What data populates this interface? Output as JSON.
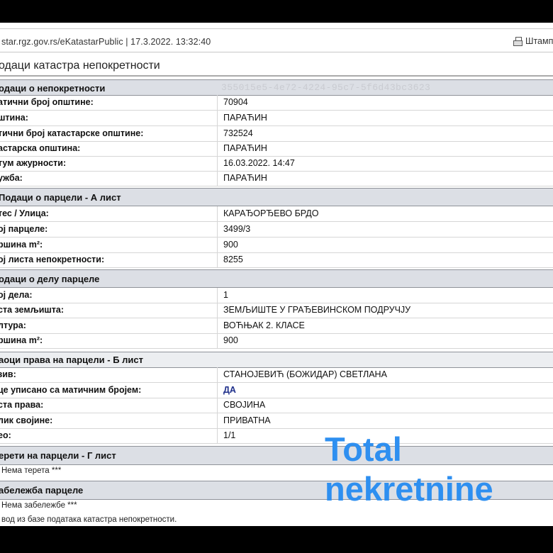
{
  "url_line": "star.rgz.gov.rs/eKatastarPublic | 17.3.2022. 13:32:40",
  "print_label": "Штамп",
  "page_title": "одаци катастра непокретности",
  "sections": {
    "property": {
      "title": "одаци о непокретности",
      "uuid": "355015e5-4e72-4224-95c7-5f6d43bc3623"
    },
    "parcel": {
      "title": "Подаци о парцели - А лист"
    },
    "part": {
      "title": "одаци о делу парцеле"
    },
    "rights": {
      "title": "аоци права на парцели - Б лист"
    },
    "burdens": {
      "title": "ерети на парцели - Г лист"
    },
    "notes": {
      "title": "абележба парцеле"
    }
  },
  "property_rows": [
    {
      "label": "атични број општине:",
      "value": "70904"
    },
    {
      "label": "штина:",
      "value": "ПАРАЋИН"
    },
    {
      "label": "тични број катастарске општине:",
      "value": "732524"
    },
    {
      "label": "астарска општина:",
      "value": "ПАРАЋИН"
    },
    {
      "label": "тум ажурности:",
      "value": "16.03.2022. 14:47"
    },
    {
      "label": "ужба:",
      "value": "ПАРАЋИН"
    }
  ],
  "parcel_rows": [
    {
      "label": "тес / Улица:",
      "value": "КАРАЂОРЂЕВО БРДО"
    },
    {
      "label": "ој парцеле:",
      "value": "3499/3"
    },
    {
      "label": "ршина m²:",
      "value": "900"
    },
    {
      "label": "ој листа непокретности:",
      "value": "8255"
    }
  ],
  "part_rows": [
    {
      "label": "ој дела:",
      "value": "1"
    },
    {
      "label": "ста земљишта:",
      "value": "ЗЕМЉИШТЕ У ГРАЂЕВИНСКОМ ПОДРУЧЈУ"
    },
    {
      "label": "лтура:",
      "value": "ВОЋЊАК 2. КЛАСЕ"
    },
    {
      "label": "ршина m²:",
      "value": "900"
    }
  ],
  "rights_rows": [
    {
      "label": "зив:",
      "value": "СТАНОЈЕВИЋ (БОЖИДАР) СВЕТЛАНА"
    },
    {
      "label": "це уписано са матичним бројем:",
      "value": "ДА"
    },
    {
      "label": "ста права:",
      "value": "СВОЈИНА"
    },
    {
      "label": "лик својине:",
      "value": "ПРИВАТНА"
    },
    {
      "label": "ео:",
      "value": "1/1"
    }
  ],
  "burdens_note": "Нема терета ***",
  "notes_note": "Нема забележбе ***",
  "footer_note": "вод из базе података катастра непокретности.",
  "watermark": {
    "line1": "Total",
    "line2": "nekretnine"
  }
}
